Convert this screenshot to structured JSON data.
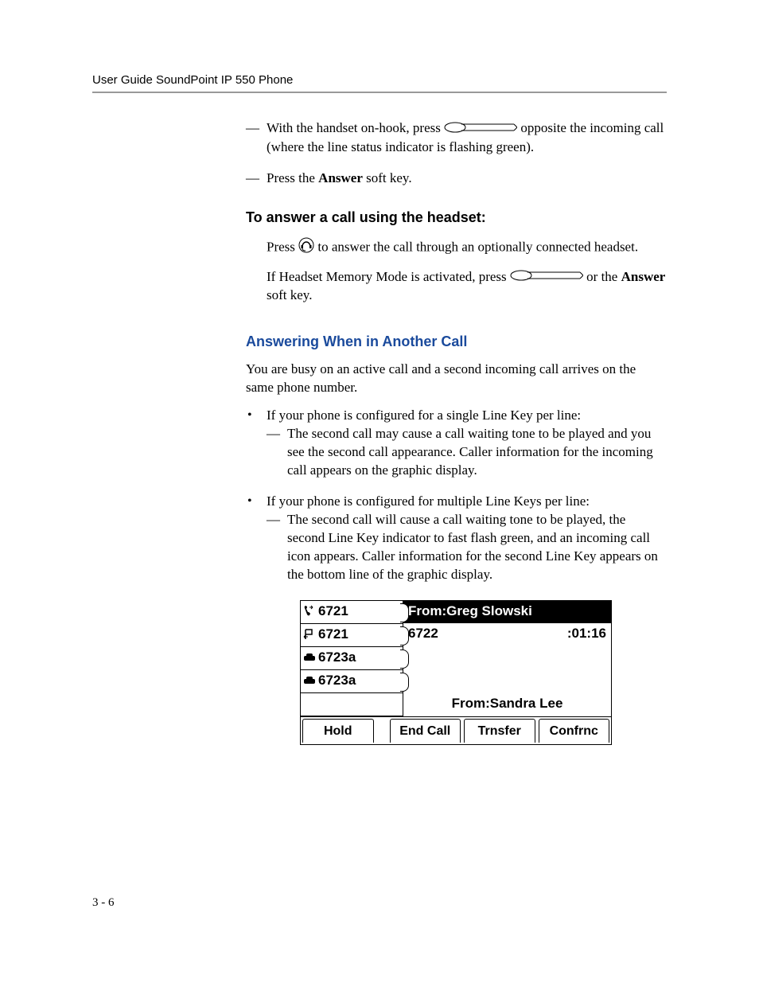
{
  "header": {
    "title": "User Guide SoundPoint IP 550 Phone"
  },
  "section1": {
    "item1_a": "With the handset on-hook, press ",
    "item1_b": " opposite the incoming call (where the line status indicator is flashing green).",
    "item2_a": "Press the ",
    "item2_bold": "Answer",
    "item2_b": " soft key."
  },
  "headset": {
    "heading": "To answer a call using the headset:",
    "line1_a": "Press ",
    "line1_b": " to answer the call through an optionally connected headset.",
    "line2_a": "If Headset Memory Mode is activated, press ",
    "line2_b": " or the ",
    "line2_bold": "Answer",
    "line2_c": " soft key."
  },
  "another": {
    "heading": "Answering When in Another Call",
    "intro": "You are busy on an active call and a second incoming call arrives on the same phone number.",
    "b1": "If your phone is configured for a single Line Key per line:",
    "b1_sub": "The second call may cause a call waiting tone to be played and you see the second call appearance. Caller information for the incoming call appears on the graphic display.",
    "b2": "If your phone is configured for multiple Line Keys per line:",
    "b2_sub": "The second call will cause a call waiting tone to be played, the second Line Key indicator to fast flash green, and an incoming call icon appears. Caller information for the second Line Key appears on the bottom line of the graphic display."
  },
  "phone": {
    "lines": [
      "6721",
      "6721",
      "6723a",
      "6723a"
    ],
    "from1": "From:Greg Slowski",
    "active_num": "6722",
    "timer": ":01:16",
    "from2": "From:Sandra Lee",
    "softkeys": [
      "Hold",
      "End Call",
      "Trnsfer",
      "Confrnc"
    ]
  },
  "footer": {
    "pagenum": "3 - 6"
  }
}
